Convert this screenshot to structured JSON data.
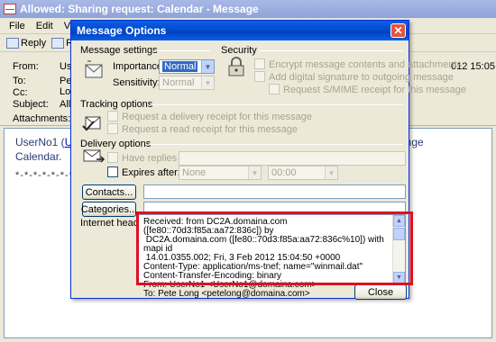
{
  "main_window": {
    "title": "Allowed: Sharing request: Calendar - Message",
    "menu": [
      "File",
      "Edit",
      "View"
    ],
    "toolbar": {
      "reply": "Reply",
      "reply_all": "Re"
    },
    "header": {
      "from_label": "From:",
      "from_value": "UserNo",
      "to_label": "To:",
      "to_value": "Pete Lon",
      "cc_label": "Cc:",
      "subject_label": "Subject:",
      "subject_value": "Allowed",
      "sent_value": "012 15:05",
      "attachments_label": "Attachments:"
    },
    "body": {
      "line1_prefix": "UserNo1 (",
      "line1_link": "Use",
      "line1_suffix": "ange",
      "line2": "Calendar.",
      "separator": "*-*-*-*-*-*-*-*"
    }
  },
  "dialog": {
    "title": "Message Options",
    "close_glyph": "✕",
    "message_settings": {
      "label": "Message settings",
      "importance_label": "Importance:",
      "importance_value": "Normal",
      "sensitivity_label": "Sensitivity:",
      "sensitivity_value": "Normal"
    },
    "security": {
      "label": "Security",
      "encrypt": "Encrypt message contents and attachments",
      "signature": "Add digital signature to outgoing message",
      "smime": "Request S/MIME receipt for this message"
    },
    "tracking": {
      "label": "Tracking options",
      "delivery_receipt": "Request a delivery receipt for this message",
      "read_receipt": "Request a read receipt for this message"
    },
    "delivery": {
      "label": "Delivery options",
      "replies_label": "Have replies sent to:",
      "expires_label": "Expires after:",
      "expires_date": "None",
      "expires_time": "00:00"
    },
    "contacts_button": "Contacts...",
    "categories_button": "Categories...",
    "internet_headers_label": "Internet headers:",
    "internet_headers_text": "Received: from DC2A.domaina.com ([fe80::70d3:f85a:aa72:836c]) by\n DC2A.domaina.com ([fe80::70d3:f85a:aa72:836c%10]) with mapi id\n 14.01.0355.002; Fri, 3 Feb 2012 15:04:50 +0000\nContent-Type: application/ms-tnef; name=\"winmail.dat\"\nContent-Transfer-Encoding: binary\nFrom: UserNo1 <UserNo1@domaina.com>\nTo: Pete Long <petelong@domaina.com>",
    "close_button": "Close"
  },
  "colors": {
    "dialog_title": "#0a5fe6",
    "highlight_border": "#e01020",
    "window_bg": "#ece9d8"
  }
}
